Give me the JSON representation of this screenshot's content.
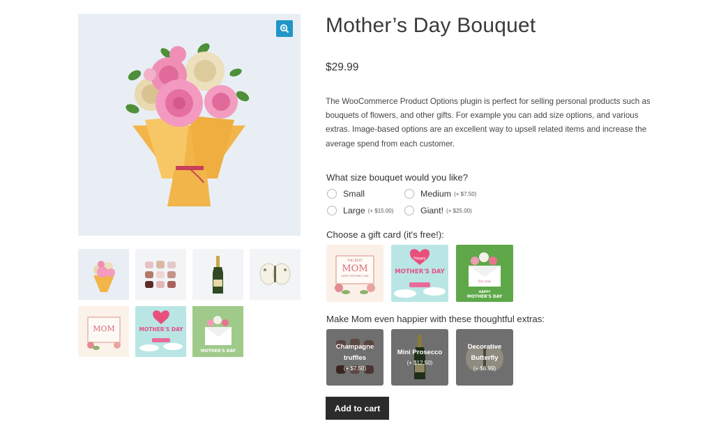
{
  "product": {
    "title": "Mother’s Day Bouquet",
    "price": "$29.99",
    "description": "The WooCommerce Product Options plugin is perfect for selling personal products such as bouquets of flowers, and other gifts. For example you can add size options, and various extras. Image-based options are an excellent way to upsell related items and increase the average spend from each customer."
  },
  "gallery": {
    "main_image": "bouquet",
    "zoom_icon": "zoom-in-icon",
    "thumbnails": [
      "bouquet",
      "chocolate-truffles",
      "prosecco-bottle",
      "butterfly",
      "best-mom-card",
      "happy-mothers-day-card",
      "envelope-flowers-card"
    ]
  },
  "size_option": {
    "label": "What size bouquet would you like?",
    "choices": [
      {
        "label": "Small",
        "price": ""
      },
      {
        "label": "Medium",
        "price": "(+ $7.50)"
      },
      {
        "label": "Large",
        "price": "(+ $15.00)"
      },
      {
        "label": "Giant!",
        "price": "(+ $25.00)"
      }
    ]
  },
  "gift_card_option": {
    "label": "Choose a gift card (it's free!):",
    "cards": [
      {
        "name": "best-mom-card",
        "lines": [
          "THE BEST",
          "MOM",
          "HAPPY MOTHER'S DAY"
        ]
      },
      {
        "name": "happy-mothers-day-card",
        "lines": [
          "Happy",
          "MOTHER'S DAY"
        ]
      },
      {
        "name": "envelope-flowers-card",
        "lines": [
          "for you",
          "HAPPY",
          "MOTHER'S DAY"
        ]
      }
    ]
  },
  "extras_option": {
    "label": "Make Mom even happier with these thoughtful extras:",
    "items": [
      {
        "name": "Champagne truffles",
        "line1": "Champagne",
        "line2": "truffles",
        "price": "(+ $7.50)"
      },
      {
        "name": "Mini Prosecco",
        "line1": "Mini Prosecco",
        "line2": "",
        "price": "(+ $12.50)"
      },
      {
        "name": "Decorative Butterfly",
        "line1": "Decorative",
        "line2": "Butterfly",
        "price": "(+ $6.99)"
      }
    ]
  },
  "add_to_cart_label": "Add to cart",
  "colors": {
    "accent": "#2196c7",
    "button_bg": "#2b2b2b",
    "image_bg": "#e8eef3"
  }
}
